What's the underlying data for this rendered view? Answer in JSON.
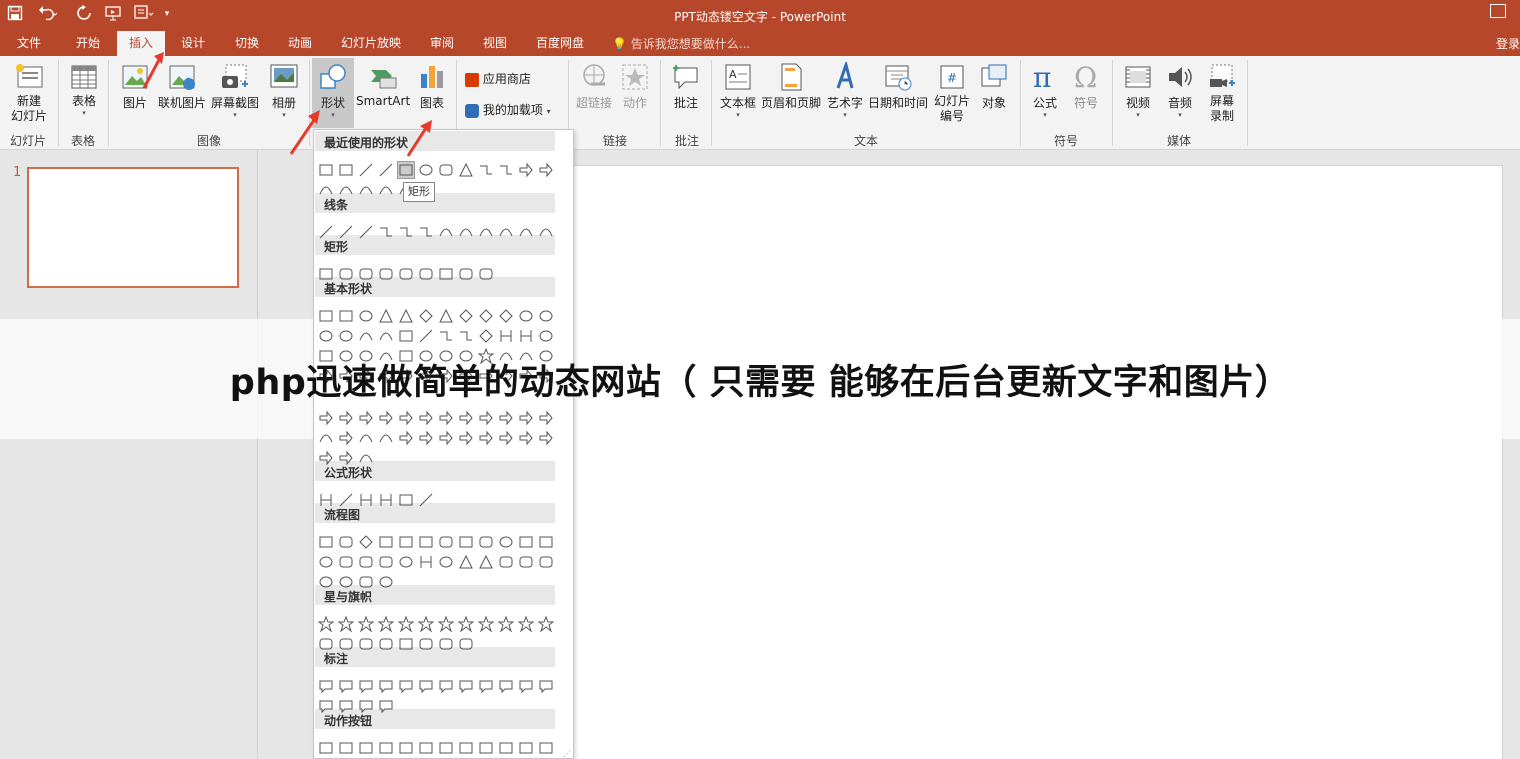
{
  "window": {
    "title": "PPT动态镂空文字 - PowerPoint"
  },
  "tabs": [
    {
      "label": "文件",
      "active": false
    },
    {
      "label": "开始",
      "active": false
    },
    {
      "label": "插入",
      "active": true
    },
    {
      "label": "设计",
      "active": false
    },
    {
      "label": "切换",
      "active": false
    },
    {
      "label": "动画",
      "active": false
    },
    {
      "label": "幻灯片放映",
      "active": false
    },
    {
      "label": "审阅",
      "active": false
    },
    {
      "label": "视图",
      "active": false
    },
    {
      "label": "百度网盘",
      "active": false
    }
  ],
  "tellme": "告诉我您想要做什么...",
  "login": "登录",
  "ribbon": {
    "new_slide": "新建\n幻灯片",
    "table": "表格",
    "picture": "图片",
    "online_picture": "联机图片",
    "screenshot": "屏幕截图",
    "album": "相册",
    "shapes": "形状",
    "smartart": "SmartArt",
    "chart": "图表",
    "app_store": "应用商店",
    "my_addins": "我的加载项",
    "hyperlink": "超链接",
    "action": "动作",
    "comment": "批注",
    "textbox": "文本框",
    "header_footer": "页眉和页脚",
    "wordart": "艺术字",
    "datetime": "日期和时间",
    "slide_number": "幻灯片\n编号",
    "object": "对象",
    "equation": "公式",
    "symbol": "符号",
    "video": "视频",
    "audio": "音频",
    "screen_record": "屏幕\n录制",
    "groups": {
      "slides": "幻灯片",
      "tables": "表格",
      "images": "图像",
      "links": "链接",
      "comments": "批注",
      "text": "文本",
      "symbols": "符号",
      "media": "媒体"
    }
  },
  "shapes_menu": {
    "sections": [
      "最近使用的形状",
      "线条",
      "矩形",
      "基本形状",
      "公式形状",
      "流程图",
      "星与旗帜",
      "标注",
      "动作按钮"
    ],
    "tooltip": "矩形"
  },
  "slide_panel": {
    "slide_number": "1"
  },
  "banner": {
    "text": "php迅速做简单的动态网站（ 只需要 能够在后台更新文字和图片）"
  },
  "colors": {
    "accent": "#b7472a",
    "arrow": "#e53b2c",
    "thumb_border": "#d26a4c"
  }
}
